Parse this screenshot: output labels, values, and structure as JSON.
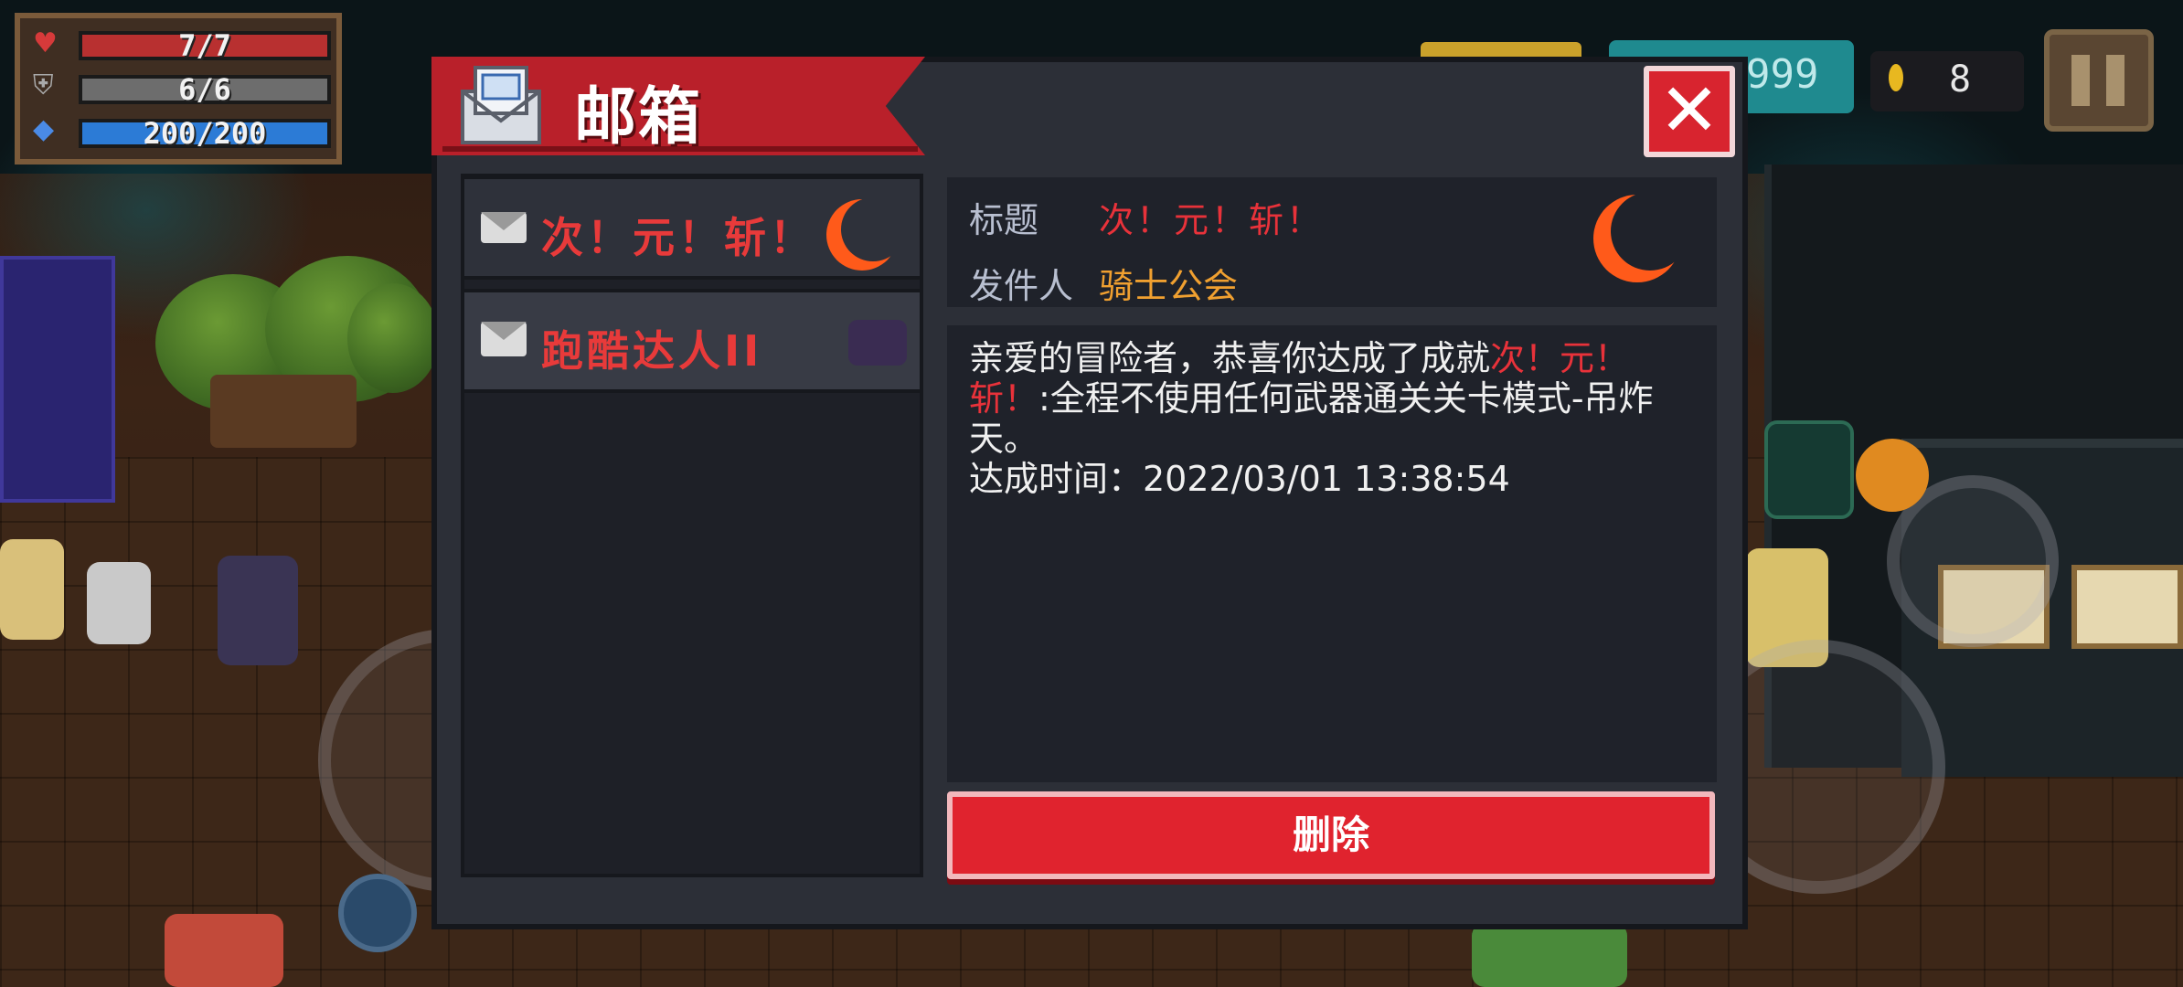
{
  "hud": {
    "hp": "7/7",
    "armor": "6/6",
    "energy": "200/200",
    "gems_partial": "999",
    "coins": "8"
  },
  "mailbox": {
    "title": "邮箱",
    "mails": [
      {
        "label": "次！元！斩！",
        "selected": true
      },
      {
        "label": "跑酷达人II",
        "selected": false
      }
    ],
    "detail": {
      "subject_key": "标题",
      "subject_value": "次！元！斩！",
      "sender_key": "发件人",
      "sender_value": "骑士公会",
      "body_prefix": "亲爱的冒险者，恭喜你达成了成就",
      "body_highlight": "次！元！斩！",
      "body_suffix": ":全程不使用任何武器通关关卡模式-吊炸天。",
      "achieved_line": "达成时间：2022/03/01 13:38:54"
    },
    "delete_label": "删除"
  },
  "colors": {
    "accent_red": "#d8242f",
    "sender_gold": "#f0a030",
    "highlight_red": "#e8323a"
  }
}
